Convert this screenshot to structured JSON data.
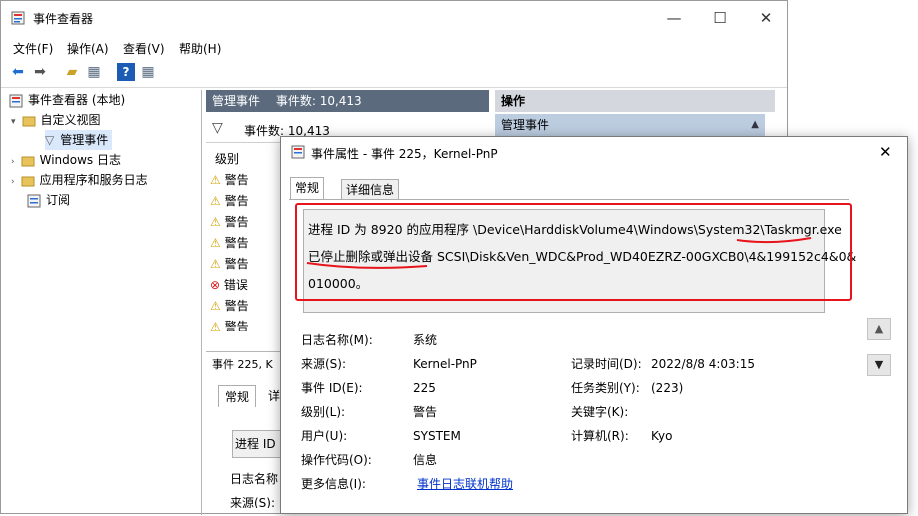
{
  "window": {
    "title": "事件查看器",
    "min_glyph": "—",
    "max_glyph": "☐",
    "close_glyph": "✕"
  },
  "menu": [
    "文件(F)",
    "操作(A)",
    "查看(V)",
    "帮助(H)"
  ],
  "tree": {
    "root": "事件查看器 (本地)",
    "custom_views": "自定义视图",
    "admin_events": "管理事件",
    "windows_logs": "Windows 日志",
    "app_service_logs": "应用程序和服务日志",
    "subscriptions": "订阅"
  },
  "middle": {
    "header_title": "管理事件",
    "header_count": "事件数: 10,413",
    "filter_count": "事件数: 10,413",
    "col_level": "级别",
    "rows": [
      "警告",
      "警告",
      "警告",
      "警告",
      "警告",
      "错误",
      "警告",
      "警告"
    ],
    "bottom_title": "事件 225, K",
    "bottom_tab_general": "常规",
    "bottom_tab_detail": "详",
    "bottom_msg": "进程 ID",
    "bottom_log_name": "日志名称",
    "bottom_source": "来源(S):"
  },
  "right": {
    "header": "操作",
    "sub": "管理事件"
  },
  "dialog": {
    "title": "事件属性 - 事件 225，Kernel-PnP",
    "close_glyph": "✕",
    "tabs": [
      "常规",
      "详细信息"
    ],
    "message_lines": [
      "进程 ID 为 8920 的应用程序 \\Device\\HarddiskVolume4\\Windows\\System32\\Taskmgr.exe",
      "已停止删除或弹出设备 SCSI\\Disk&Ven_WDC&Prod_WD40EZRZ-00GXCB0\\4&199152c4&0&",
      "010000。"
    ],
    "fields": {
      "log_name_label": "日志名称(M):",
      "log_name": "系统",
      "source_label": "来源(S):",
      "source": "Kernel-PnP",
      "logged_label": "记录时间(D):",
      "logged": "2022/8/8 4:03:15",
      "event_id_label": "事件 ID(E):",
      "event_id": "225",
      "task_label": "任务类别(Y):",
      "task": "(223)",
      "level_label": "级别(L):",
      "level": "警告",
      "keywords_label": "关键字(K):",
      "keywords": "",
      "user_label": "用户(U):",
      "user": "SYSTEM",
      "computer_label": "计算机(R):",
      "computer": "Kyo",
      "opcode_label": "操作代码(O):",
      "opcode": "信息",
      "more_info_label": "更多信息(I):",
      "more_info_link": "事件日志联机帮助"
    }
  },
  "colors": {
    "annotation": "#e8141c",
    "header_bg": "#5b6b7d",
    "link": "#0033cc"
  }
}
